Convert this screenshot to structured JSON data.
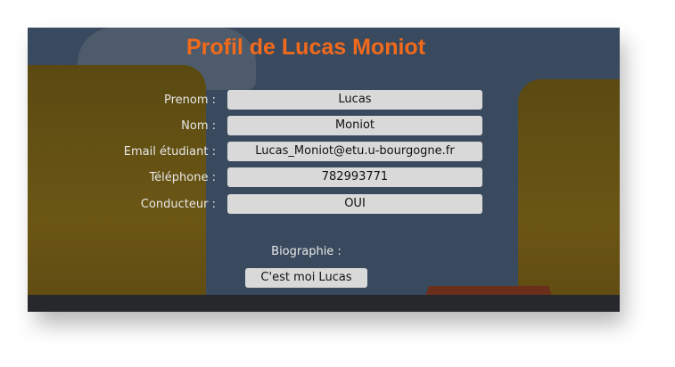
{
  "page": {
    "title": "Profil de Lucas Moniot"
  },
  "profile": {
    "fields": [
      {
        "label": "Prenom :",
        "value": "Lucas"
      },
      {
        "label": "Nom :",
        "value": "Moniot"
      },
      {
        "label": "Email étudiant :",
        "value": "Lucas_Moniot@etu.u-bourgogne.fr"
      },
      {
        "label": "Téléphone :",
        "value": "782993771"
      },
      {
        "label": "Conducteur :",
        "value": "OUI"
      }
    ],
    "biography_label": "Biographie :",
    "biography_value": "C'est moi Lucas"
  },
  "colors": {
    "title": "#f26a1b",
    "field_bg": "#d9d9d9",
    "label": "#e8e8e8"
  }
}
